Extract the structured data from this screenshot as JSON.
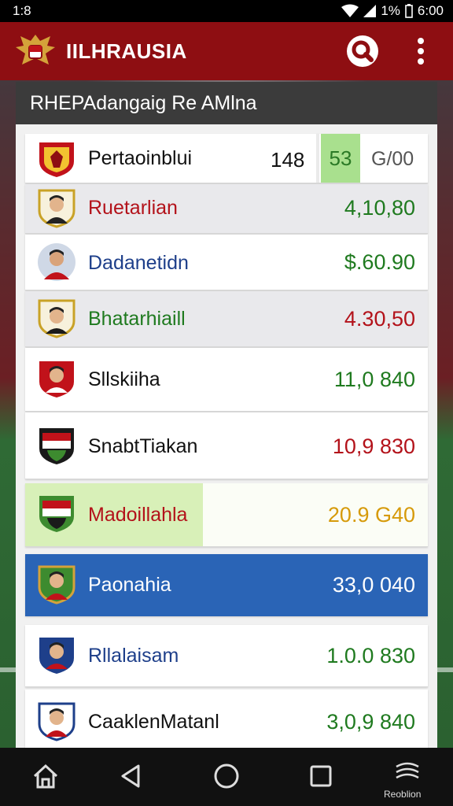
{
  "status_bar": {
    "time": "1:8",
    "battery": "1%",
    "clock": "6:00"
  },
  "app": {
    "title": "IILHRAUSIA",
    "icons": {
      "logo": "garuda-emblem",
      "search": "search-icon",
      "more": "more-vert-icon"
    },
    "colors": {
      "appbar": "#8e0e12",
      "panel_header": "#3b3b3b",
      "selected_row": "#2a64b6",
      "highlight_row": "#d8f0b8"
    }
  },
  "panel": {
    "header": "RHEPAdangaig Re AMlna",
    "header_row": {
      "name": "Pertaoinblui",
      "rank": "148",
      "points": "53",
      "extra": "G/00"
    },
    "rows": [
      {
        "name": "Ruetarlian",
        "value": "4,10,80",
        "value_color": "#1f7a1f"
      },
      {
        "name": "Dadanetidn",
        "value": "$.60.90",
        "value_color": "#1f7a1f"
      },
      {
        "name": "Bhatarhiaill",
        "value": "4.30,50",
        "value_color": "#b3121a"
      },
      {
        "name": "Sllskiiha",
        "value": "11,0 840",
        "value_color": "#1f7a1f"
      },
      {
        "name": "SnabtTiakan",
        "value": "10,9 830",
        "value_color": "#b3121a"
      },
      {
        "name": "Madoillahla",
        "value": "20.9 G40",
        "value_color": "#d69a0a"
      },
      {
        "name": "Paonahia",
        "value": "33,0 040",
        "value_color": "#ffffff"
      },
      {
        "name": "Rllalaisam",
        "value": "1.0.0 830",
        "value_color": "#1f7a1f"
      },
      {
        "name": "CaaklenMatanl",
        "value": "3,0,9 840",
        "value_color": "#1f7a1f"
      }
    ]
  },
  "navbar": {
    "label": "Reoblion",
    "icons": [
      "home-icon",
      "back-icon",
      "circle-home-icon",
      "recents-icon",
      "app-icon"
    ]
  }
}
